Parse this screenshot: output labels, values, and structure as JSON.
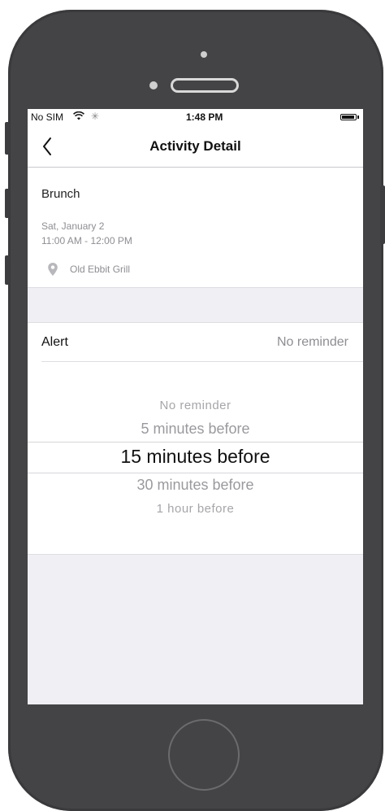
{
  "status_bar": {
    "carrier": "No SIM",
    "wifi_icon": "wifi-icon",
    "activity_icon": "activity-spinner-icon",
    "time": "1:48 PM",
    "battery_icon": "battery-icon"
  },
  "nav": {
    "back_icon": "chevron-left-icon",
    "title": "Activity Detail"
  },
  "activity": {
    "name": "Brunch",
    "date": "Sat, January 2",
    "time_range": "11:00 AM - 12:00 PM",
    "location_icon": "map-pin-icon",
    "location": "Old Ebbit Grill"
  },
  "alert": {
    "label": "Alert",
    "value": "No reminder",
    "options": [
      "No reminder",
      "5 minutes before",
      "15 minutes before",
      "30 minutes before",
      "1 hour before"
    ],
    "selected_index": 2
  },
  "colors": {
    "device": "#444446",
    "screen_bg": "#efeff4",
    "secondary_text": "#8e8e93"
  }
}
